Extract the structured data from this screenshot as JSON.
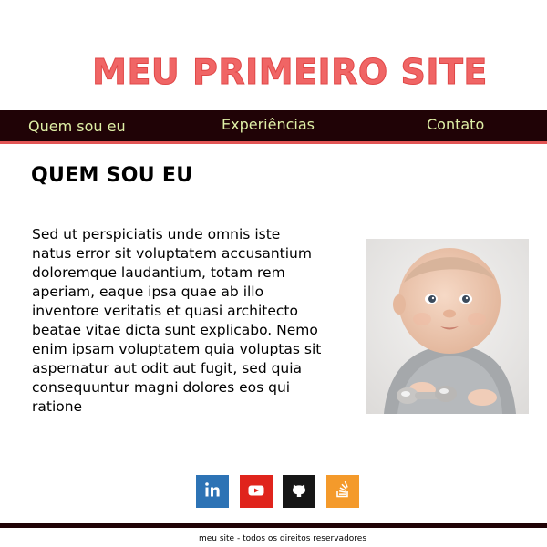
{
  "header": {
    "site_title": "MEU PRIMEIRO SITE"
  },
  "nav": {
    "items": [
      {
        "label": "Quem sou eu"
      },
      {
        "label": "Experiências"
      },
      {
        "label": "Contato"
      }
    ]
  },
  "main": {
    "section_title": "QUEM SOU EU",
    "paragraph": "Sed ut perspiciatis unde omnis iste natus error sit voluptatem accusantium doloremque laudantium, totam rem aperiam, eaque ipsa quae ab illo inventore veritatis et quasi architecto beatae vitae dicta sunt explicabo. Nemo enim ipsam voluptatem quia voluptas sit aspernatur aut odit aut fugit, sed quia consequuntur magni dolores eos qui ratione",
    "photo": {
      "subject": "baby-photo"
    }
  },
  "social": {
    "icons": [
      {
        "icon": "linkedin-icon",
        "color": "#2d73b5"
      },
      {
        "icon": "youtube-icon",
        "color": "#e0241c"
      },
      {
        "icon": "github-icon",
        "color": "#161616"
      },
      {
        "icon": "stackoverflow-icon",
        "color": "#f49a2b"
      }
    ]
  },
  "footer": {
    "text": "meu site - todos os direitos reservadores"
  },
  "colors": {
    "title": "#f06565",
    "nav_background": "#200306",
    "nav_text": "#dff0a6",
    "nav_border": "#e25555"
  }
}
